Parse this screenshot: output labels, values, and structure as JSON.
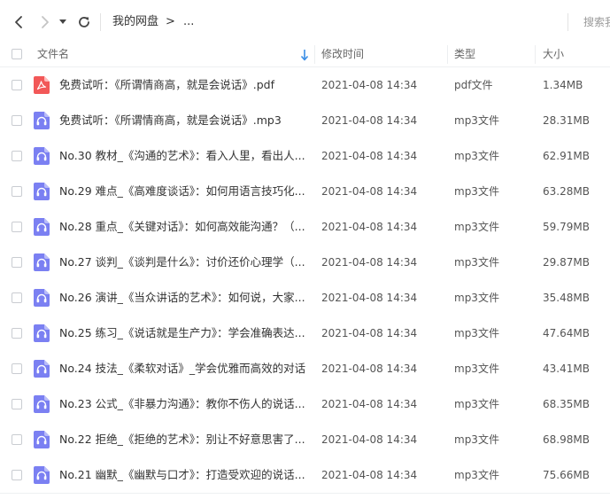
{
  "toolbar": {
    "breadcrumb_root": "我的网盘",
    "breadcrumb_sep": ">",
    "breadcrumb_more": "...",
    "search_placeholder": "搜索我"
  },
  "columns": {
    "name": "文件名",
    "modified": "修改时间",
    "type": "类型",
    "size": "大小"
  },
  "files": [
    {
      "icon": "pdf-icon",
      "name": "免费试听：《所谓情商高，就是会说话》.pdf",
      "modified": "2021-04-08 14:34",
      "type": "pdf文件",
      "size": "1.34MB"
    },
    {
      "icon": "audio-icon",
      "name": "免费试听：《所谓情商高，就是会说话》.mp3",
      "modified": "2021-04-08 14:34",
      "type": "mp3文件",
      "size": "28.31MB"
    },
    {
      "icon": "audio-icon",
      "name": "No.30 教材_《沟通的艺术》：看入人里，看出人...",
      "modified": "2021-04-08 14:34",
      "type": "mp3文件",
      "size": "62.91MB"
    },
    {
      "icon": "audio-icon",
      "name": "No.29 难点_《高难度谈话》：如何用语言技巧化...",
      "modified": "2021-04-08 14:34",
      "type": "mp3文件",
      "size": "63.28MB"
    },
    {
      "icon": "audio-icon",
      "name": "No.28 重点_《关键对话》：如何高效能沟通？（...",
      "modified": "2021-04-08 14:34",
      "type": "mp3文件",
      "size": "59.79MB"
    },
    {
      "icon": "audio-icon",
      "name": "No.27 谈判_《谈判是什么》：讨价还价心理学（...",
      "modified": "2021-04-08 14:34",
      "type": "mp3文件",
      "size": "29.87MB"
    },
    {
      "icon": "audio-icon",
      "name": "No.26 演讲_《当众讲话的艺术》：如何说，大家...",
      "modified": "2021-04-08 14:34",
      "type": "mp3文件",
      "size": "35.48MB"
    },
    {
      "icon": "audio-icon",
      "name": "No.25 练习_《说话就是生产力》：学会准确表达...",
      "modified": "2021-04-08 14:34",
      "type": "mp3文件",
      "size": "47.64MB"
    },
    {
      "icon": "audio-icon",
      "name": "No.24 技法_《柔软对话》_学会优雅而高效的对话...",
      "modified": "2021-04-08 14:34",
      "type": "mp3文件",
      "size": "43.41MB"
    },
    {
      "icon": "audio-icon",
      "name": "No.23 公式_《非暴力沟通》：教你不伤人的说话...",
      "modified": "2021-04-08 14:34",
      "type": "mp3文件",
      "size": "68.35MB"
    },
    {
      "icon": "audio-icon",
      "name": "No.22 拒绝_《拒绝的艺术》：别让不好意思害了...",
      "modified": "2021-04-08 14:34",
      "type": "mp3文件",
      "size": "68.98MB"
    },
    {
      "icon": "audio-icon",
      "name": "No.21 幽默_《幽默与口才》：打造受欢迎的说话...",
      "modified": "2021-04-08 14:34",
      "type": "mp3文件",
      "size": "75.66MB"
    }
  ],
  "colors": {
    "accent": "#3a8ee6",
    "audio_icon": "#7b80f2",
    "pdf_icon": "#f25858"
  }
}
